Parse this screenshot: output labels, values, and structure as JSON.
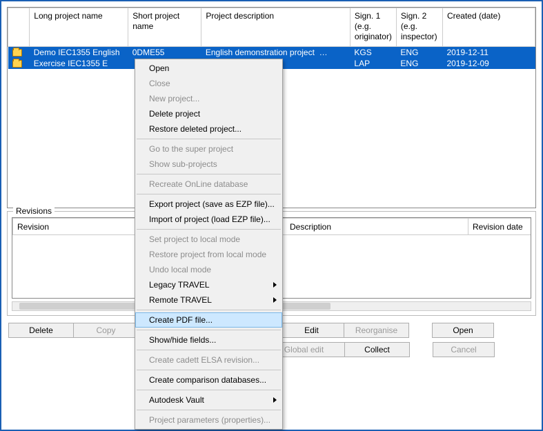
{
  "columns": {
    "icon": "",
    "long": "Long project name",
    "short": "Short project name",
    "desc": "Project description",
    "s1": "Sign. 1 (e.g. originator)",
    "s2": "Sign. 2 (e.g. inspector)",
    "date": "Created (date)"
  },
  "rows": [
    {
      "long": "Demo IEC1355 English",
      "short": "0DME55",
      "desc": "English demonstration project",
      "s1": "KGS",
      "s2": "ENG",
      "date": "2019-12-11"
    },
    {
      "long": "Exercise IEC1355 E",
      "short": "",
      "desc": "",
      "s1": "LAP",
      "s2": "ENG",
      "date": "2019-12-09"
    }
  ],
  "revisions": {
    "group_label": "Revisions",
    "headers": {
      "rev": "Revision",
      "desc": "Description",
      "date": "Revision date"
    }
  },
  "buttons": {
    "row1": [
      "Delete",
      "Copy",
      "",
      "",
      "Edit",
      "Reorganise",
      "Open"
    ],
    "row1_dis": [
      false,
      true,
      false,
      false,
      false,
      true,
      false
    ],
    "row2": [
      "",
      "",
      "",
      "Global edit",
      "Collect",
      "Cancel"
    ],
    "row2_dis": [
      false,
      false,
      false,
      true,
      false,
      true
    ],
    "delete": "Delete",
    "copy": "Copy",
    "edit": "Edit",
    "reorganise": "Reorganise",
    "open": "Open",
    "global_edit": "Global edit",
    "collect": "Collect",
    "cancel": "Cancel"
  },
  "ctx": {
    "open": "Open",
    "close": "Close",
    "new_project": "New project...",
    "delete_project": "Delete project",
    "restore_deleted": "Restore deleted project...",
    "go_super": "Go to the super project",
    "show_sub": "Show sub-projects",
    "recreate_online": "Recreate OnLine database",
    "export_ezp": "Export project (save as EZP file)...",
    "import_ezp": "Import of project (load EZP file)...",
    "set_local": "Set project to local mode",
    "restore_local": "Restore project from local mode",
    "undo_local": "Undo local mode",
    "legacy_travel": "Legacy TRAVEL",
    "remote_travel": "Remote TRAVEL",
    "create_pdf": "Create PDF file...",
    "show_hide_fields": "Show/hide fields...",
    "create_cadett": "Create cadett ELSA revision...",
    "create_comparison": "Create comparison databases...",
    "autodesk_vault": "Autodesk Vault",
    "project_params": "Project parameters (properties)..."
  }
}
